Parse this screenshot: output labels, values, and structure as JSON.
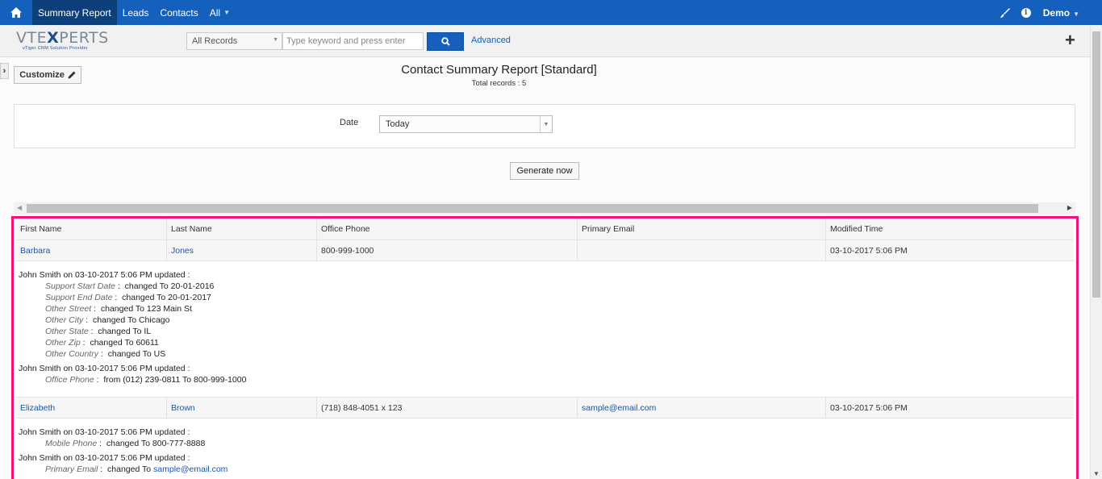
{
  "nav": {
    "items": [
      {
        "label": "Summary Report",
        "active": true
      },
      {
        "label": "Leads"
      },
      {
        "label": "Contacts"
      },
      {
        "label": "All"
      }
    ],
    "user": "Demo"
  },
  "header": {
    "logo": {
      "main_left": "VTE",
      "main_x": "X",
      "main_right": "PERTS",
      "sub": "vTiger CRM Solution Provider"
    },
    "record_filter": "All Records",
    "search_placeholder": "Type keyword and press enter",
    "advanced_label": "Advanced"
  },
  "customize_label": "Customize",
  "report": {
    "title": "Contact Summary Report [Standard]",
    "total": "Total records : 5"
  },
  "filter": {
    "date_label": "Date",
    "date_value": "Today"
  },
  "generate_label": "Generate now",
  "table": {
    "columns": [
      "First Name",
      "Last Name",
      "Office Phone",
      "Primary Email",
      "Modified Time"
    ],
    "rows": [
      {
        "first": "Barbara",
        "last": "Jones",
        "phone": "800-999-1000",
        "email": "",
        "modified": "03-10-2017 5:06 PM",
        "history": [
          {
            "header": "John Smith on 03-10-2017 5:06 PM updated :",
            "changes": [
              {
                "field": "Support Start Date",
                "text": "changed To 20-01-2016"
              },
              {
                "field": "Support End Date",
                "text": "changed To 20-01-2017"
              },
              {
                "field": "Other Street",
                "text": "changed To 123 Main St"
              },
              {
                "field": "Other City",
                "text": "changed To Chicago"
              },
              {
                "field": "Other State",
                "text": "changed To IL"
              },
              {
                "field": "Other Zip",
                "text": "changed To 60611"
              },
              {
                "field": "Other Country",
                "text": "changed To US"
              }
            ]
          },
          {
            "header": "John Smith on 03-10-2017 5:06 PM updated :",
            "changes": [
              {
                "field": "Office Phone",
                "text": "from (012) 239-0811 To 800-999-1000"
              }
            ]
          }
        ]
      },
      {
        "first": "Elizabeth",
        "last": "Brown",
        "phone": "(718) 848-4051 x 123",
        "email": "sample@email.com",
        "modified": "03-10-2017 5:06 PM",
        "history": [
          {
            "header": "John Smith on 03-10-2017 5:06 PM updated :",
            "changes": [
              {
                "field": "Mobile Phone",
                "text": "changed To 800-777-8888"
              }
            ]
          },
          {
            "header": "John Smith on 03-10-2017 5:06 PM updated :",
            "changes": [
              {
                "field": "Primary Email",
                "text": "changed To",
                "link": "sample@email.com"
              }
            ]
          }
        ]
      }
    ]
  }
}
